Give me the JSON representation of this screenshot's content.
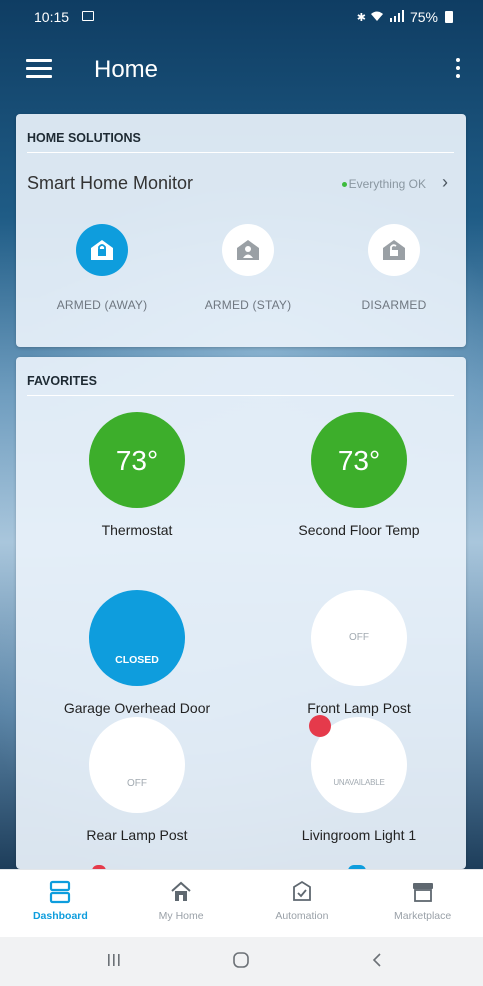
{
  "status_bar": {
    "time": "10:15",
    "battery": "75%"
  },
  "app_bar": {
    "title": "Home"
  },
  "home_solutions": {
    "header": "HOME SOLUTIONS",
    "monitor_label": "Smart Home Monitor",
    "status_text": "Everything OK",
    "modes": [
      {
        "label": "ARMED (AWAY)",
        "active": true
      },
      {
        "label": "ARMED (STAY)",
        "active": false
      },
      {
        "label": "DISARMED",
        "active": false
      }
    ]
  },
  "favorites": {
    "header": "FAVORITES",
    "items": [
      {
        "name": "Thermostat",
        "value": "73°"
      },
      {
        "name": "Second Floor Temp",
        "value": "73°"
      },
      {
        "name": "Garage Overhead Door",
        "state": "CLOSED"
      },
      {
        "name": "Front Lamp Post",
        "state": "OFF"
      },
      {
        "name": "Rear Lamp Post",
        "state": "OFF"
      },
      {
        "name": "Livingroom Light 1",
        "state": "UNAVAILABLE"
      }
    ]
  },
  "bottom_nav": {
    "items": [
      {
        "label": "Dashboard",
        "active": true
      },
      {
        "label": "My Home",
        "active": false
      },
      {
        "label": "Automation",
        "active": false
      },
      {
        "label": "Marketplace",
        "active": false
      }
    ]
  },
  "colors": {
    "accent_blue": "#0e9ddd",
    "thermo_green": "#3dae2b",
    "status_green": "#3dbb3d",
    "alert_red": "#e53a4b"
  }
}
